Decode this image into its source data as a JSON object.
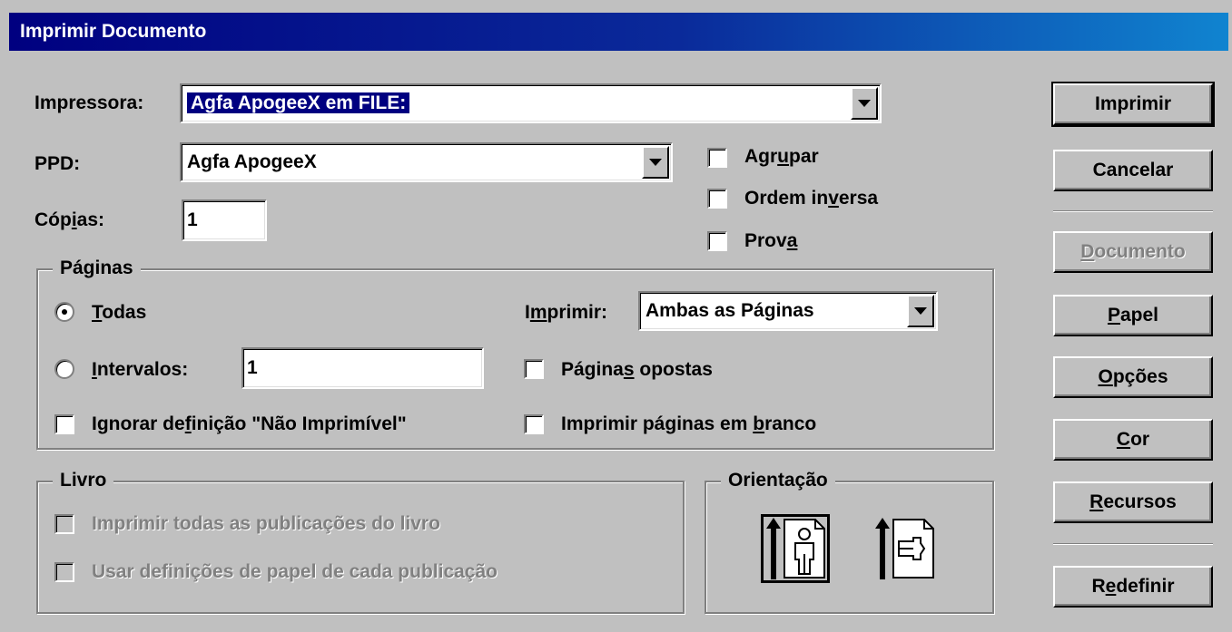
{
  "window": {
    "title": "Imprimir Documento"
  },
  "printer": {
    "label": "Impressora:",
    "value": "Agfa ApogeeX em FILE:"
  },
  "ppd": {
    "label": "PPD:",
    "value": "Agfa ApogeeX"
  },
  "copies": {
    "label_pre": "Cóp",
    "label_u": "i",
    "label_post": "as:",
    "value": "1"
  },
  "options": {
    "collate": {
      "pre": "Agr",
      "u": "u",
      "post": "par",
      "checked": false
    },
    "reverse": {
      "pre": "Ordem in",
      "u": "v",
      "post": "ersa",
      "checked": false
    },
    "proof": {
      "pre": "Prov",
      "u": "a",
      "post": "",
      "checked": false
    }
  },
  "pages": {
    "title": "Páginas",
    "all": {
      "pre": "",
      "u": "T",
      "post": "odas",
      "selected": true
    },
    "ranges": {
      "pre": "",
      "u": "I",
      "post": "ntervalos:",
      "value": "1",
      "selected": false
    },
    "print_label": {
      "pre": "I",
      "u": "m",
      "post": "primir:"
    },
    "print_value": "Ambas as Páginas",
    "opposite": {
      "pre": "Página",
      "u": "s",
      "post": " opostas",
      "checked": false
    },
    "ignore_nonprintable": {
      "pre": "Ignorar de",
      "u": "f",
      "post": "inição \"Não Imprimível\"",
      "checked": false
    },
    "blank_pages": {
      "pre": "Imprimir páginas em ",
      "u": "b",
      "post": "ranco",
      "checked": false
    }
  },
  "book": {
    "title": "Livro",
    "print_all": "Imprimir todas as publicações do livro",
    "use_paper": "Usar definições de papel de cada publicação"
  },
  "orientation": {
    "title": "Orientação"
  },
  "buttons": {
    "print": "Imprimir",
    "cancel": "Cancelar",
    "document": {
      "pre": "",
      "u": "D",
      "post": "ocumento"
    },
    "paper": {
      "pre": "",
      "u": "P",
      "post": "apel"
    },
    "options": {
      "pre": "",
      "u": "O",
      "post": "pções"
    },
    "color": {
      "pre": "",
      "u": "C",
      "post": "or"
    },
    "resources": {
      "pre": "",
      "u": "R",
      "post": "ecursos"
    },
    "reset": {
      "pre": "R",
      "u": "e",
      "post": "definir"
    }
  }
}
